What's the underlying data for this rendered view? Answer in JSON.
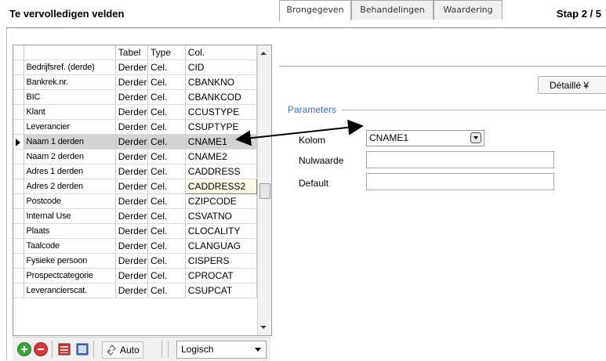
{
  "header": {
    "title": "Te vervolledigen velden",
    "step": "Stap  2 / 5"
  },
  "grid": {
    "columns": [
      "",
      "Tabel",
      "Type",
      "Col."
    ],
    "rows": [
      {
        "desc": "Bedrijfsref. (derde)",
        "tabel": "Derder",
        "type": "Cel.",
        "col": "CID"
      },
      {
        "desc": "Bankrek.nr.",
        "tabel": "Derder",
        "type": "Cel.",
        "col": "CBANKNO"
      },
      {
        "desc": "BIC",
        "tabel": "Derder",
        "type": "Cel.",
        "col": "CBANKCOD"
      },
      {
        "desc": "Klant",
        "tabel": "Derder",
        "type": "Cel.",
        "col": "CCUSTYPE"
      },
      {
        "desc": "Leverancier",
        "tabel": "Derder",
        "type": "Cel.",
        "col": "CSUPTYPE"
      },
      {
        "desc": "Naam 1 derden",
        "tabel": "Derder",
        "type": "Cel.",
        "col": "CNAME1"
      },
      {
        "desc": "Naam 2 derden",
        "tabel": "Derder",
        "type": "Cel.",
        "col": "CNAME2"
      },
      {
        "desc": "Adres 1 derden",
        "tabel": "Derder",
        "type": "Cel.",
        "col": "CADDRESS"
      },
      {
        "desc": "Adres 2 derden",
        "tabel": "Derder",
        "type": "Cel.",
        "col": "CADDRESS2"
      },
      {
        "desc": "Postcode",
        "tabel": "Derder",
        "type": "Cel.",
        "col": "CZIPCODE"
      },
      {
        "desc": "Internal Use",
        "tabel": "Derder",
        "type": "Cel.",
        "col": "CSVATNO"
      },
      {
        "desc": "Plaats",
        "tabel": "Derder",
        "type": "Cel.",
        "col": "CLOCALITY"
      },
      {
        "desc": "Taalcode",
        "tabel": "Derder",
        "type": "Cel.",
        "col": "CLANGUAG"
      },
      {
        "desc": "Fysieke persoon",
        "tabel": "Derder",
        "type": "Cel.",
        "col": "CISPERS"
      },
      {
        "desc": "Prospectcategorie",
        "tabel": "Derder",
        "type": "Cel.",
        "col": "CPROCAT"
      },
      {
        "desc": "Leverancierscat.",
        "tabel": "Derder",
        "type": "Cel.",
        "col": "CSUPCAT"
      }
    ]
  },
  "toolbar": {
    "auto_label": "Auto",
    "mode_value": "Logisch"
  },
  "tabs": [
    "Brongegeven",
    "Behandelingen",
    "Waardering"
  ],
  "detail_button": "Détaillé  ¥",
  "parameters": {
    "title": "Parameters",
    "kolom_label": "Kolom",
    "kolom_value": "CNAME1",
    "nulwaarde_label": "Nulwaarde",
    "nulwaarde_value": "",
    "default_label": "Default",
    "default_value": ""
  },
  "colors": {
    "accent": "#3b6fc6",
    "selected_row": "#d3d3d3",
    "edit_cell": "#fffde5"
  }
}
